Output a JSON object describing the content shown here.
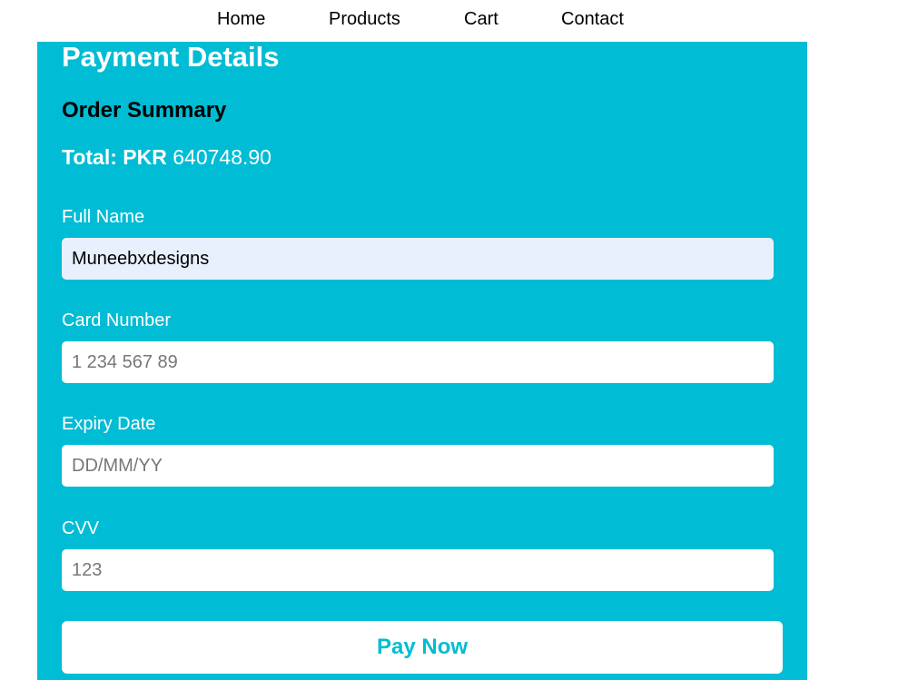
{
  "nav": {
    "items": [
      {
        "label": "Home"
      },
      {
        "label": "Products"
      },
      {
        "label": "Cart"
      },
      {
        "label": "Contact"
      }
    ]
  },
  "payment": {
    "title": "Payment Details",
    "summary_heading": "Order Summary",
    "total_label": "Total: PKR",
    "total_value": "640748.90"
  },
  "form": {
    "full_name": {
      "label": "Full Name",
      "value": "Muneebxdesigns",
      "placeholder": ""
    },
    "card_number": {
      "label": "Card Number",
      "value": "",
      "placeholder": "1 234 567 89"
    },
    "expiry_date": {
      "label": "Expiry Date",
      "value": "",
      "placeholder": "DD/MM/YY"
    },
    "cvv": {
      "label": "CVV",
      "value": "",
      "placeholder": "123"
    },
    "submit_label": "Pay Now"
  },
  "colors": {
    "panel_background": "#00bcd4",
    "autofill_background": "#e8f0fe",
    "button_text": "#00bcd4"
  }
}
